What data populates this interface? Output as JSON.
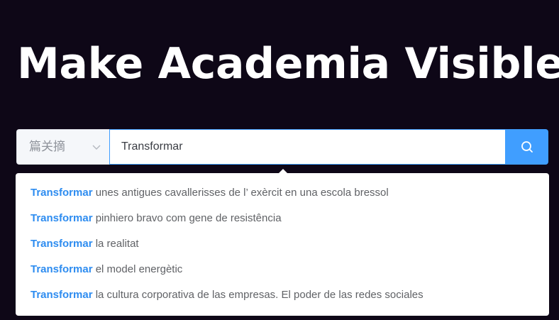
{
  "hero": {
    "title": "Make Academia Visible"
  },
  "search": {
    "select_value": "篇关摘",
    "input_value": "Transformar",
    "button_icon": "search-icon"
  },
  "suggestions": [
    {
      "match": "Transformar",
      "rest": " unes antigues cavallerisses de l’ exèrcit en una escola bressol"
    },
    {
      "match": "Transformar",
      "rest": " pinhiero bravo com gene de resistência"
    },
    {
      "match": "Transformar",
      "rest": " la realitat"
    },
    {
      "match": "Transformar",
      "rest": " el model energètic"
    },
    {
      "match": "Transformar",
      "rest": " la cultura corporativa de las empresas. El poder de las redes sociales"
    }
  ],
  "colors": {
    "background": "#0e0717",
    "accent": "#409eff",
    "match_text": "#2d8cf0"
  }
}
